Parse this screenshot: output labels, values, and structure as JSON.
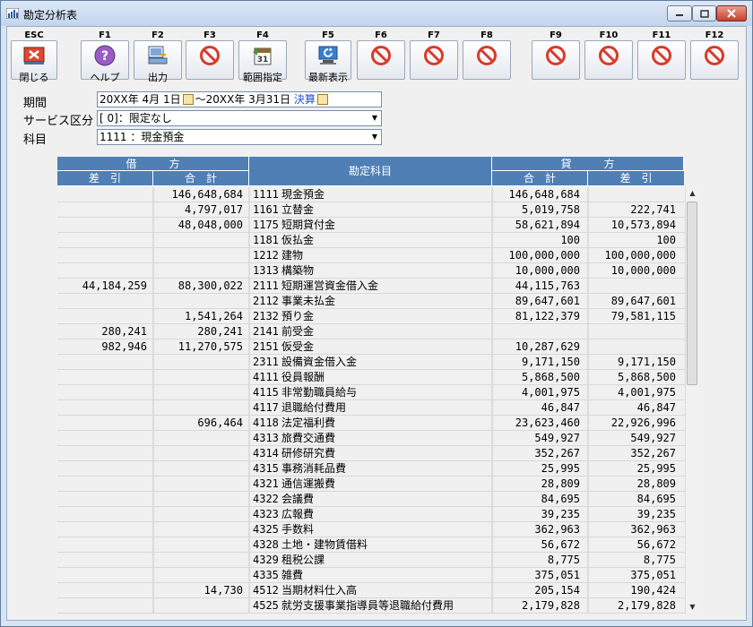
{
  "window": {
    "title": "勘定分析表"
  },
  "toolbar": {
    "buttons": [
      {
        "key": "ESC",
        "label": "閉じる",
        "icon": "close-window-icon"
      },
      {
        "key": "F1",
        "label": "ヘルプ",
        "icon": "help-icon"
      },
      {
        "key": "F2",
        "label": "出力",
        "icon": "output-icon"
      },
      {
        "key": "F3",
        "label": "",
        "icon": "disabled-icon"
      },
      {
        "key": "F4",
        "label": "範囲指定",
        "icon": "calendar-icon"
      },
      {
        "key": "F5",
        "label": "最新表示",
        "icon": "refresh-icon"
      },
      {
        "key": "F6",
        "label": "",
        "icon": "disabled-icon"
      },
      {
        "key": "F7",
        "label": "",
        "icon": "disabled-icon"
      },
      {
        "key": "F8",
        "label": "",
        "icon": "disabled-icon"
      },
      {
        "key": "F9",
        "label": "",
        "icon": "disabled-icon"
      },
      {
        "key": "F10",
        "label": "",
        "icon": "disabled-icon"
      },
      {
        "key": "F11",
        "label": "",
        "icon": "disabled-icon"
      },
      {
        "key": "F12",
        "label": "",
        "icon": "disabled-icon"
      }
    ]
  },
  "form": {
    "period_label": "期間",
    "period_start": "20XX年 4月 1日",
    "period_sep": "～",
    "period_end": "20XX年 3月31日",
    "settlement": "決算",
    "service_label": "サービス区分",
    "service_value": "[    0]：限定なし",
    "subject_label": "科目",
    "subject_value": "1111       ：現金預金"
  },
  "table": {
    "debit_header": "借　　　方",
    "credit_header": "貸　　　方",
    "account_header": "勘定科目",
    "diff_header": "差　引",
    "total_header": "合　計",
    "rows": [
      {
        "lsa": "",
        "lgk": "146,648,684",
        "code": "1111",
        "name": "現金預金",
        "rgk": "146,648,684",
        "rsa": ""
      },
      {
        "lsa": "",
        "lgk": "4,797,017",
        "code": "1161",
        "name": "立替金",
        "rgk": "5,019,758",
        "rsa": "222,741"
      },
      {
        "lsa": "",
        "lgk": "48,048,000",
        "code": "1175",
        "name": "短期貸付金",
        "rgk": "58,621,894",
        "rsa": "10,573,894"
      },
      {
        "lsa": "",
        "lgk": "",
        "code": "1181",
        "name": "仮払金",
        "rgk": "100",
        "rsa": "100"
      },
      {
        "lsa": "",
        "lgk": "",
        "code": "1212",
        "name": "建物",
        "rgk": "100,000,000",
        "rsa": "100,000,000"
      },
      {
        "lsa": "",
        "lgk": "",
        "code": "1313",
        "name": "構築物",
        "rgk": "10,000,000",
        "rsa": "10,000,000"
      },
      {
        "lsa": "44,184,259",
        "lgk": "88,300,022",
        "code": "2111",
        "name": "短期運営資金借入金",
        "rgk": "44,115,763",
        "rsa": ""
      },
      {
        "lsa": "",
        "lgk": "",
        "code": "2112",
        "name": "事業未払金",
        "rgk": "89,647,601",
        "rsa": "89,647,601"
      },
      {
        "lsa": "",
        "lgk": "1,541,264",
        "code": "2132",
        "name": "預り金",
        "rgk": "81,122,379",
        "rsa": "79,581,115"
      },
      {
        "lsa": "280,241",
        "lgk": "280,241",
        "code": "2141",
        "name": "前受金",
        "rgk": "",
        "rsa": ""
      },
      {
        "lsa": "982,946",
        "lgk": "11,270,575",
        "code": "2151",
        "name": "仮受金",
        "rgk": "10,287,629",
        "rsa": ""
      },
      {
        "lsa": "",
        "lgk": "",
        "code": "2311",
        "name": "設備資金借入金",
        "rgk": "9,171,150",
        "rsa": "9,171,150"
      },
      {
        "lsa": "",
        "lgk": "",
        "code": "4111",
        "name": "役員報酬",
        "rgk": "5,868,500",
        "rsa": "5,868,500"
      },
      {
        "lsa": "",
        "lgk": "",
        "code": "4115",
        "name": "非常勤職員給与",
        "rgk": "4,001,975",
        "rsa": "4,001,975"
      },
      {
        "lsa": "",
        "lgk": "",
        "code": "4117",
        "name": "退職給付費用",
        "rgk": "46,847",
        "rsa": "46,847"
      },
      {
        "lsa": "",
        "lgk": "696,464",
        "code": "4118",
        "name": "法定福利費",
        "rgk": "23,623,460",
        "rsa": "22,926,996"
      },
      {
        "lsa": "",
        "lgk": "",
        "code": "4313",
        "name": "旅費交通費",
        "rgk": "549,927",
        "rsa": "549,927"
      },
      {
        "lsa": "",
        "lgk": "",
        "code": "4314",
        "name": "研修研究費",
        "rgk": "352,267",
        "rsa": "352,267"
      },
      {
        "lsa": "",
        "lgk": "",
        "code": "4315",
        "name": "事務消耗品費",
        "rgk": "25,995",
        "rsa": "25,995"
      },
      {
        "lsa": "",
        "lgk": "",
        "code": "4321",
        "name": "通信運搬費",
        "rgk": "28,809",
        "rsa": "28,809"
      },
      {
        "lsa": "",
        "lgk": "",
        "code": "4322",
        "name": "会議費",
        "rgk": "84,695",
        "rsa": "84,695"
      },
      {
        "lsa": "",
        "lgk": "",
        "code": "4323",
        "name": "広報費",
        "rgk": "39,235",
        "rsa": "39,235"
      },
      {
        "lsa": "",
        "lgk": "",
        "code": "4325",
        "name": "手数料",
        "rgk": "362,963",
        "rsa": "362,963"
      },
      {
        "lsa": "",
        "lgk": "",
        "code": "4328",
        "name": "土地・建物賃借料",
        "rgk": "56,672",
        "rsa": "56,672"
      },
      {
        "lsa": "",
        "lgk": "",
        "code": "4329",
        "name": "租税公課",
        "rgk": "8,775",
        "rsa": "8,775"
      },
      {
        "lsa": "",
        "lgk": "",
        "code": "4335",
        "name": "雑費",
        "rgk": "375,051",
        "rsa": "375,051"
      },
      {
        "lsa": "",
        "lgk": "14,730",
        "code": "4512",
        "name": "当期材料仕入高",
        "rgk": "205,154",
        "rsa": "190,424"
      },
      {
        "lsa": "",
        "lgk": "",
        "code": "4525",
        "name": "就労支援事業指導員等退職給付費用",
        "rgk": "2,179,828",
        "rsa": "2,179,828"
      }
    ]
  },
  "colors": {
    "header_bg": "#4f7fb5",
    "link_blue": "#1f4fd6"
  }
}
